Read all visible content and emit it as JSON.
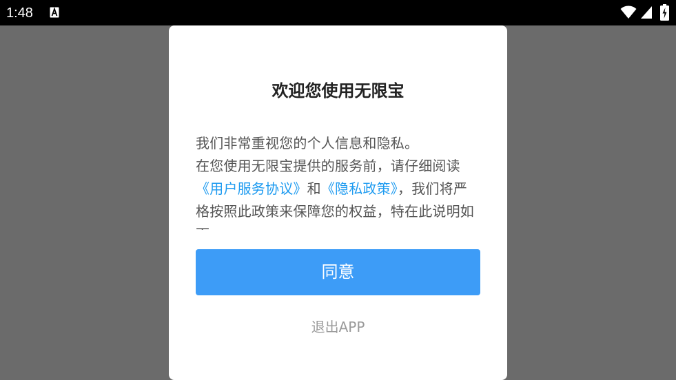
{
  "status_bar": {
    "time": "1:48",
    "icons": [
      "a-notification-icon",
      "wifi-icon",
      "signal-icon",
      "battery-charging-icon"
    ]
  },
  "dialog": {
    "title": "欢迎您使用无限宝",
    "body_line1": "我们非常重视您的个人信息和隐私。",
    "body_line2_pre": "在您使用无限宝提供的服务前，请仔细阅读",
    "link_user_agreement": "《用户服务协议》",
    "body_and": "和",
    "link_privacy_policy": "《隐私政策》",
    "body_line2_post": "，我们将严格按照此政策来保障您的权益，特在此说明如下",
    "agree_label": "同意",
    "exit_label": "退出APP"
  },
  "colors": {
    "accent": "#3d9cf7",
    "link": "#1e9bf0",
    "scrim": "#6b6b6b",
    "status_bar": "#000000"
  }
}
